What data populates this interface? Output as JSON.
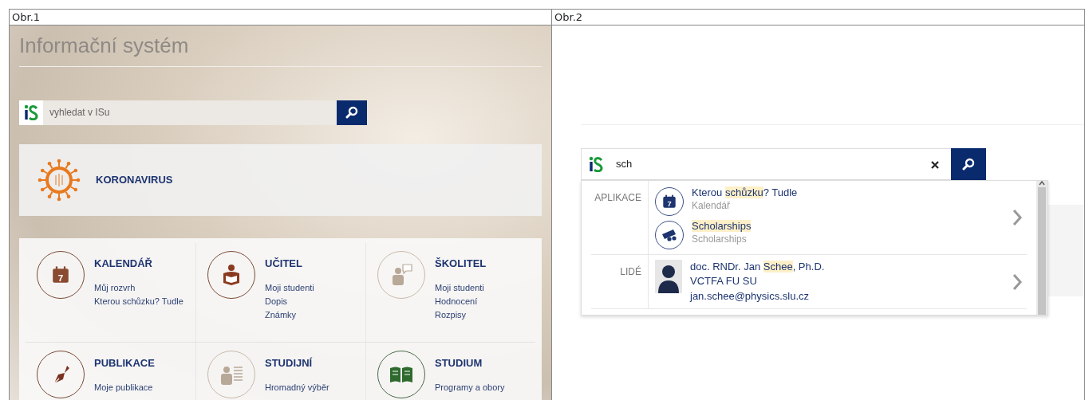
{
  "figure_1": {
    "caption": "Obr.1",
    "title": "Informační systém",
    "search": {
      "placeholder": "vyhledat v ISu"
    },
    "banner": {
      "label": "KORONAVIRUS"
    },
    "tiles": [
      {
        "kind": "calendar",
        "icon_label": "7",
        "title": "KALENDÁŘ",
        "links": [
          "Můj rozvrh",
          "Kterou schůzku? Tudle"
        ]
      },
      {
        "kind": "reader",
        "title": "UČITEL",
        "links": [
          "Moji studenti",
          "Dopis",
          "Známky"
        ]
      },
      {
        "kind": "speaker",
        "title": "ŠKOLITEL",
        "links": [
          "Moji studenti",
          "Hodnocení",
          "Rozpisy"
        ]
      },
      {
        "kind": "pen",
        "title": "PUBLIKACE",
        "links": [
          "Moje publikace"
        ]
      },
      {
        "kind": "list",
        "title": "STUDIJNÍ",
        "links": [
          "Hromadný výběr"
        ]
      },
      {
        "kind": "book",
        "title": "STUDIUM",
        "links": [
          "Programy a obory"
        ]
      }
    ]
  },
  "figure_2": {
    "caption": "Obr.2",
    "search": {
      "value": "sch"
    },
    "results": [
      {
        "section": "APLIKACE",
        "items": [
          {
            "kind": "calendar",
            "icon_label": "7",
            "title": [
              {
                "text": "Kterou ",
                "highlighted": false
              },
              {
                "text": "schůzku",
                "highlighted": true
              },
              {
                "text": "? Tudle",
                "highlighted": false
              }
            ],
            "subtitle": "Kalendář"
          },
          {
            "kind": "ticket",
            "title": [
              {
                "text": "Scholarships",
                "highlighted": true
              }
            ],
            "subtitle": "Scholarships"
          }
        ]
      },
      {
        "section": "LIDÉ",
        "items": [
          {
            "kind": "person",
            "title": [
              {
                "text": "doc. RNDr. Jan ",
                "highlighted": false
              },
              {
                "text": "Schee",
                "highlighted": true
              },
              {
                "text": ", Ph.D.",
                "highlighted": false
              }
            ],
            "details": [
              "VCTFA FU SU",
              "jan.schee@physics.slu.cz"
            ]
          }
        ]
      }
    ]
  }
}
